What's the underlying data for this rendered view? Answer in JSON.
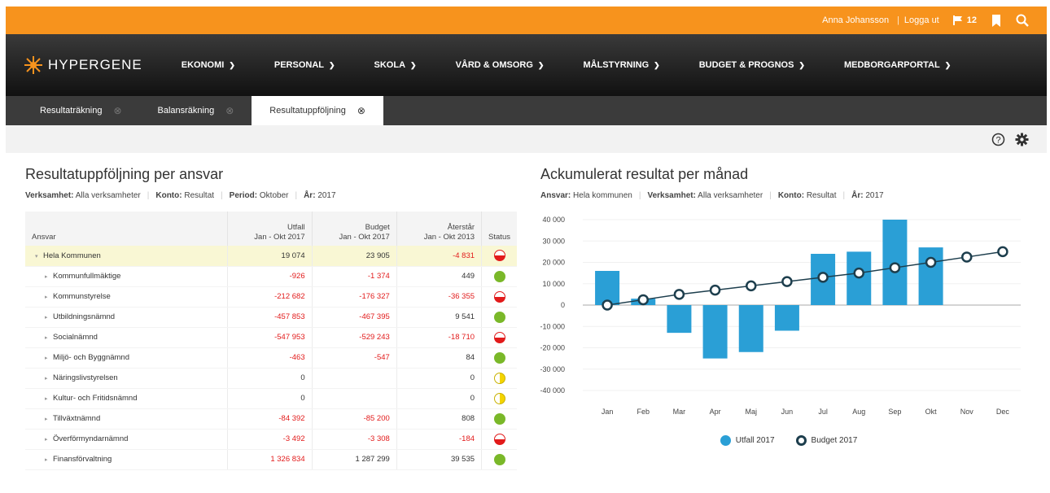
{
  "topbar": {
    "user": "Anna Johansson",
    "logout": "Logga ut",
    "flag_count": "12",
    "colors": {
      "bg": "#f7931d"
    }
  },
  "brand": {
    "name": "HYPERGENE"
  },
  "nav": [
    {
      "label": "EKONOMI"
    },
    {
      "label": "PERSONAL"
    },
    {
      "label": "SKOLA"
    },
    {
      "label": "VÅRD & OMSORG"
    },
    {
      "label": "MÅLSTYRNING"
    },
    {
      "label": "BUDGET & PROGNOS"
    },
    {
      "label": "MEDBORGARPORTAL"
    }
  ],
  "tabs": [
    {
      "label": "Resultaträkning",
      "active": false
    },
    {
      "label": "Balansräkning",
      "active": false
    },
    {
      "label": "Resultatuppföljning",
      "active": true
    }
  ],
  "left": {
    "title": "Resultatuppföljning per ansvar",
    "filters": [
      {
        "key": "Verksamhet:",
        "value": "Alla verksamheter"
      },
      {
        "key": "Konto:",
        "value": "Resultat"
      },
      {
        "key": "Period:",
        "value": "Oktober"
      },
      {
        "key": "År:",
        "value": "2017"
      }
    ],
    "columns": {
      "ansvar": "Ansvar",
      "utfall_1": "Utfall",
      "utfall_2": "Jan - Okt 2017",
      "budget_1": "Budget",
      "budget_2": "Jan - Okt 2017",
      "aterstar_1": "Återstår",
      "aterstar_2": "Jan - Okt 2013",
      "status": "Status"
    },
    "rows": [
      {
        "name": "Hela Kommunen",
        "utfall": "19 074",
        "utfall_neg": false,
        "budget": "23 905",
        "budget_neg": false,
        "aterstar": "-4 831",
        "aterstar_neg": true,
        "status": "red",
        "level": 0
      },
      {
        "name": "Kommunfullmäktige",
        "utfall": "-926",
        "utfall_neg": true,
        "budget": "-1 374",
        "budget_neg": true,
        "aterstar": "449",
        "aterstar_neg": false,
        "status": "green",
        "level": 1
      },
      {
        "name": "Kommunstyrelse",
        "utfall": "-212 682",
        "utfall_neg": true,
        "budget": "-176 327",
        "budget_neg": true,
        "aterstar": "-36 355",
        "aterstar_neg": true,
        "status": "red",
        "level": 1
      },
      {
        "name": "Utbildningsnämnd",
        "utfall": "-457 853",
        "utfall_neg": true,
        "budget": "-467 395",
        "budget_neg": true,
        "aterstar": "9 541",
        "aterstar_neg": false,
        "status": "green",
        "level": 1
      },
      {
        "name": "Socialnämnd",
        "utfall": "-547 953",
        "utfall_neg": true,
        "budget": "-529 243",
        "budget_neg": true,
        "aterstar": "-18 710",
        "aterstar_neg": true,
        "status": "red",
        "level": 1
      },
      {
        "name": "Miljö- och Byggnämnd",
        "utfall": "-463",
        "utfall_neg": true,
        "budget": "-547",
        "budget_neg": true,
        "aterstar": "84",
        "aterstar_neg": false,
        "status": "green",
        "level": 1
      },
      {
        "name": "Näringslivstyrelsen",
        "utfall": "0",
        "utfall_neg": false,
        "budget": "",
        "budget_neg": false,
        "aterstar": "0",
        "aterstar_neg": false,
        "status": "yellow",
        "level": 1
      },
      {
        "name": "Kultur- och Fritidsnämnd",
        "utfall": "0",
        "utfall_neg": false,
        "budget": "",
        "budget_neg": false,
        "aterstar": "0",
        "aterstar_neg": false,
        "status": "yellow",
        "level": 1
      },
      {
        "name": "Tillväxtnämnd",
        "utfall": "-84 392",
        "utfall_neg": true,
        "budget": "-85 200",
        "budget_neg": true,
        "aterstar": "808",
        "aterstar_neg": false,
        "status": "green",
        "level": 1
      },
      {
        "name": "Överförmyndarnämnd",
        "utfall": "-3 492",
        "utfall_neg": true,
        "budget": "-3 308",
        "budget_neg": true,
        "aterstar": "-184",
        "aterstar_neg": true,
        "status": "red",
        "level": 1
      },
      {
        "name": "Finansförvaltning",
        "utfall": "1 326 834",
        "utfall_neg": true,
        "budget": "1 287 299",
        "budget_neg": false,
        "aterstar": "39 535",
        "aterstar_neg": false,
        "status": "green",
        "level": 1
      }
    ]
  },
  "right": {
    "title": "Ackumulerat resultat per månad",
    "filters": [
      {
        "key": "Ansvar:",
        "value": "Hela kommunen"
      },
      {
        "key": "Verksamhet:",
        "value": "Alla verksamheter"
      },
      {
        "key": "Konto:",
        "value": "Resultat"
      },
      {
        "key": "År:",
        "value": "2017"
      }
    ]
  },
  "chart_data": {
    "type": "bar",
    "categories": [
      "Jan",
      "Feb",
      "Mar",
      "Apr",
      "Maj",
      "Jun",
      "Jul",
      "Aug",
      "Sep",
      "Okt",
      "Nov",
      "Dec"
    ],
    "series": [
      {
        "name": "Utfall 2017",
        "type": "bar",
        "color": "#2a9fd6",
        "values": [
          16000,
          3000,
          -13000,
          -25000,
          -22000,
          -12000,
          24000,
          25000,
          40000,
          27000,
          null,
          null
        ]
      },
      {
        "name": "Budget 2017",
        "type": "line",
        "color": "#1d3e4d",
        "values": [
          0,
          2500,
          5000,
          7000,
          9000,
          11000,
          13000,
          15000,
          17500,
          20000,
          22500,
          25000
        ]
      }
    ],
    "ylim": [
      -40000,
      40000
    ],
    "yticks": [
      40000,
      30000,
      20000,
      10000,
      0,
      -10000,
      -20000,
      -30000,
      -40000
    ],
    "ytick_labels": [
      "40 000",
      "30 000",
      "20 000",
      "10 000",
      "0",
      "-10 000",
      "-20 000",
      "-30 000",
      "-40 000"
    ],
    "legend": "bottom"
  }
}
